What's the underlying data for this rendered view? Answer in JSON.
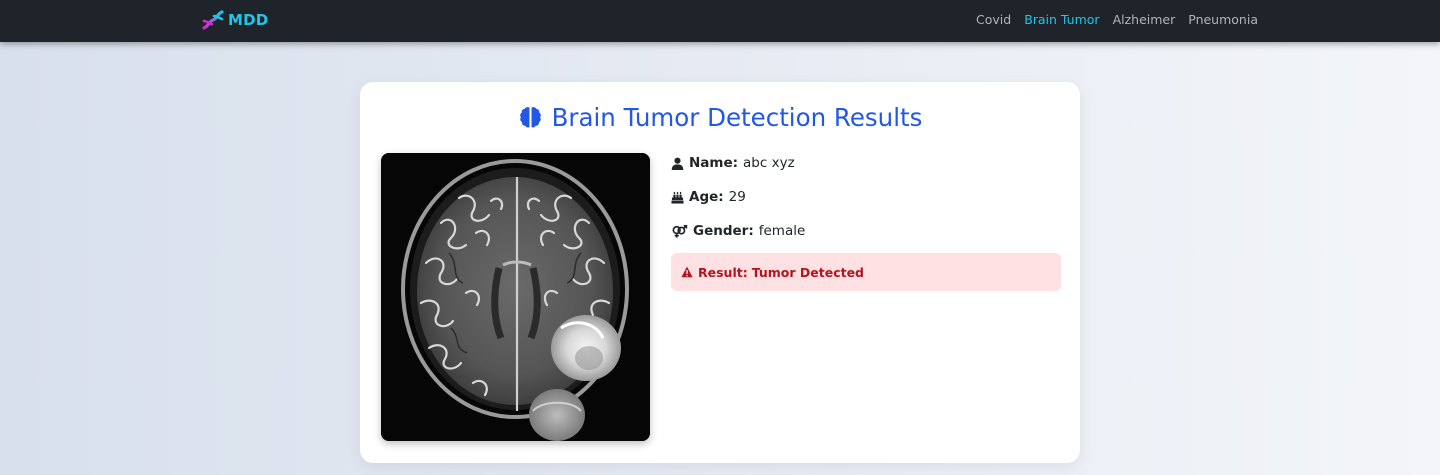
{
  "navbar": {
    "brand": "MDD",
    "links": [
      {
        "label": "Covid",
        "active": false
      },
      {
        "label": "Brain Tumor",
        "active": true
      },
      {
        "label": "Alzheimer",
        "active": false
      },
      {
        "label": "Pneumonia",
        "active": false
      }
    ]
  },
  "card": {
    "title": "Brain Tumor Detection Results",
    "title_icon": "brain-icon",
    "patient": {
      "name_label": "Name:",
      "name_value": "abc xyz",
      "age_label": "Age:",
      "age_value": "29",
      "gender_label": "Gender:",
      "gender_value": "female"
    },
    "result": {
      "label": "Result:",
      "value": "Tumor Detected",
      "icon": "warning-icon"
    }
  },
  "colors": {
    "navbar_bg": "#1f242a",
    "accent": "#1ec6e8",
    "title": "#2257e8",
    "result_bg": "#ffe0e3",
    "result_text": "#b3141e"
  }
}
